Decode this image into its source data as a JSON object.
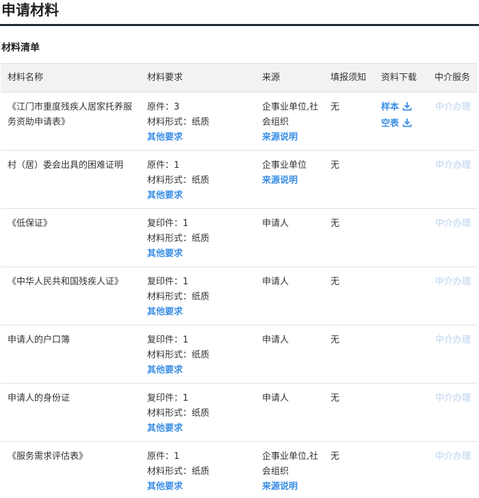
{
  "page_title": "申请材料",
  "section_title": "材料清单",
  "columns": [
    "材料名称",
    "材料要求",
    "来源",
    "填报须知",
    "资料下载",
    "中介服务"
  ],
  "rows": [
    {
      "name": "《江门市重度残疾人居家托养服务资助申请表》",
      "count": "原件：3",
      "form": "材料形式：纸质",
      "other": "其他要求",
      "source": "企事业单位,社会组织",
      "source_link": "来源说明",
      "fill": "无",
      "downloads": [
        "样本",
        "空表"
      ],
      "agent": "中介办理"
    },
    {
      "name": "村（居）委会出具的困难证明",
      "count": "原件：1",
      "form": "材料形式：纸质",
      "other": "其他要求",
      "source": "企事业单位",
      "source_link": "来源说明",
      "fill": "无",
      "downloads": [],
      "agent": "中介办理"
    },
    {
      "name": "《低保证》",
      "count": "复印件：1",
      "form": "材料形式：纸质",
      "other": "其他要求",
      "source": "申请人",
      "source_link": "",
      "fill": "无",
      "downloads": [],
      "agent": "中介办理"
    },
    {
      "name": "《中华人民共和国残疾人证》",
      "count": "复印件：1",
      "form": "材料形式：纸质",
      "other": "其他要求",
      "source": "申请人",
      "source_link": "",
      "fill": "无",
      "downloads": [],
      "agent": "中介办理"
    },
    {
      "name": "申请人的户口簿",
      "count": "复印件：1",
      "form": "材料形式：纸质",
      "other": "其他要求",
      "source": "申请人",
      "source_link": "",
      "fill": "无",
      "downloads": [],
      "agent": "中介办理"
    },
    {
      "name": "申请人的身份证",
      "count": "复印件：1",
      "form": "材料形式：纸质",
      "other": "其他要求",
      "source": "申请人",
      "source_link": "",
      "fill": "无",
      "downloads": [],
      "agent": "中介办理"
    },
    {
      "name": "《服务需求评估表》",
      "count": "原件：1",
      "form": "材料形式：纸质",
      "other": "其他要求",
      "source": "企事业单位,社会组织",
      "source_link": "来源说明",
      "fill": "无",
      "downloads": [],
      "agent": "中介办理"
    }
  ],
  "colors": {
    "link": "#3a8ee6",
    "agent_disabled": "#cfe0f3",
    "header_bg": "#f2f2f2",
    "title_rule": "#1f2a36"
  },
  "icons": {
    "download": "download-icon"
  }
}
